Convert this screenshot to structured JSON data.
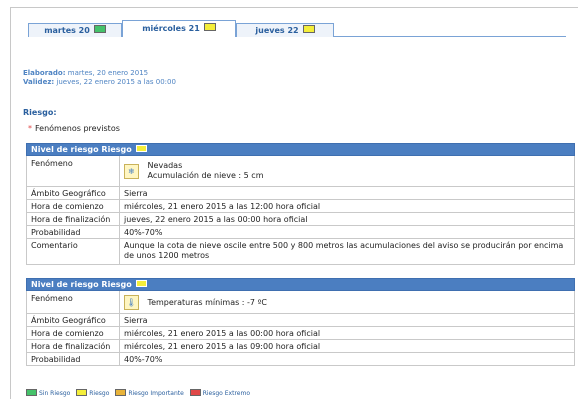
{
  "tabs": [
    {
      "label": "martes 20",
      "level_color": "#45c26a"
    },
    {
      "label": "miércoles 21",
      "level_color": "#f4ee3a"
    },
    {
      "label": "jueves 22",
      "level_color": "#f4ee3a"
    }
  ],
  "meta": {
    "elaborado_label": "Elaborado:",
    "elaborado_value": " martes, 20 enero 2015",
    "validez_label": "Validez:",
    "validez_value": " jueves, 22 enero 2015 a las 00:00"
  },
  "section_title": "Riesgo:",
  "bullet": {
    "star": "*",
    "text": "Fenómenos previstos"
  },
  "blocks": [
    {
      "header": "Nivel de riesgo Riesgo",
      "fenomeno_label": "Fenómeno",
      "fenomeno_icon": "snowflake-icon",
      "fenomeno_line1": "Nevadas",
      "fenomeno_line2": "Acumulación de nieve : 5 cm",
      "rows": [
        {
          "label": "Ámbito Geográfico",
          "value": "Sierra"
        },
        {
          "label": "Hora de comienzo",
          "value": "miércoles, 21 enero 2015 a las 12:00 hora oficial"
        },
        {
          "label": "Hora de finalización",
          "value": "jueves, 22 enero 2015 a las 00:00 hora oficial"
        },
        {
          "label": "Probabilidad",
          "value": "40%-70%"
        },
        {
          "label": "Comentario",
          "value": "Aunque la cota de nieve oscile entre 500 y 800 metros las acumulaciones del aviso se producirán por encima de unos 1200 metros"
        }
      ]
    },
    {
      "header": "Nivel de riesgo Riesgo",
      "fenomeno_label": "Fenómeno",
      "fenomeno_icon": "thermometer-icon",
      "fenomeno_line1": "Temperaturas mínimas : -7 ºC",
      "rows": [
        {
          "label": "Ámbito Geográfico",
          "value": "Sierra"
        },
        {
          "label": "Hora de comienzo",
          "value": "miércoles, 21 enero 2015 a las 00:00 hora oficial"
        },
        {
          "label": "Hora de finalización",
          "value": "miércoles, 21 enero 2015 a las 09:00 hora oficial"
        },
        {
          "label": "Probabilidad",
          "value": "40%-70%"
        }
      ]
    }
  ],
  "legend": [
    {
      "label": "Sin Riesgo",
      "color": "#45c26a"
    },
    {
      "label": "Riesgo",
      "color": "#f4ee3a"
    },
    {
      "label": "Riesgo Importante",
      "color": "#e8b33a"
    },
    {
      "label": "Riesgo Extremo",
      "color": "#e04848"
    }
  ]
}
